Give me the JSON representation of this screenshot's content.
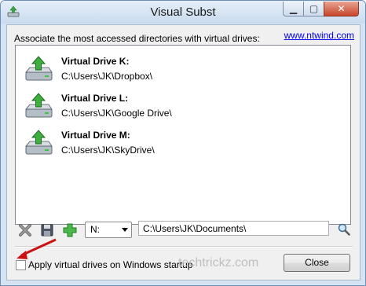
{
  "window": {
    "title": "Visual Subst"
  },
  "header": {
    "description": "Associate the most accessed directories with virtual drives:",
    "link": "www.ntwind.com"
  },
  "drives": [
    {
      "name": "Virtual Drive K:",
      "path": "C:\\Users\\JK\\Dropbox\\"
    },
    {
      "name": "Virtual Drive L:",
      "path": "C:\\Users\\JK\\Google Drive\\"
    },
    {
      "name": "Virtual Drive M:",
      "path": "C:\\Users\\JK\\SkyDrive\\"
    }
  ],
  "toolbar": {
    "drive_select": "N:",
    "path_value": "C:\\Users\\JK\\Documents\\"
  },
  "footer": {
    "startup_label": "Apply virtual drives on Windows startup",
    "startup_checked": false,
    "close_label": "Close",
    "watermark": "techtrickz.com"
  },
  "icons": {
    "app": "drive-icon",
    "remove": "remove-icon",
    "save": "save-icon",
    "add": "add-icon",
    "browse": "search-icon"
  },
  "colors": {
    "title_bar": "#c9dbee",
    "close_button": "#c7452b",
    "link": "#0000ee",
    "annotation_arrow": "#cc1111"
  }
}
